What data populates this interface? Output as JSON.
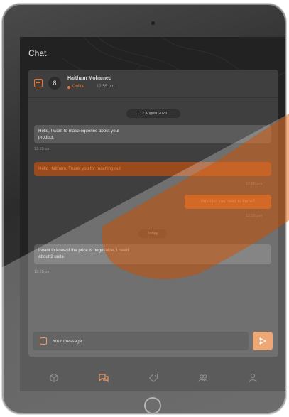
{
  "screen": {
    "title": "Chat"
  },
  "contact": {
    "initial": "8",
    "name": "Haitham Mohamed",
    "status": "Online",
    "time": "12:55 pm"
  },
  "messages": {
    "day1": "12 August 2023",
    "m1_line1": "Hello, I want to make equeries about your",
    "m1_line2": "product.",
    "m1_time": "12:55 pm",
    "m2": "Hello Haitham, Thank you for reaching out",
    "m2_time": "12:55 pm",
    "m3": "What do you need to know?",
    "m3_time": "12:55 pm",
    "day2": "Today",
    "m4_line1": "I want to know if the price is negotiable, I need",
    "m4_line2": "about 2 units.",
    "m4_time": "12:55 pm"
  },
  "composer": {
    "placeholder": "Your message"
  },
  "nav": {
    "items": [
      "box-icon",
      "chat-icon",
      "tag-icon",
      "users-icon",
      "profile-icon"
    ],
    "active": "chat-icon"
  },
  "colors": {
    "accent": "#e7752d",
    "background": "#222222",
    "panel": "#3f3f3f"
  }
}
